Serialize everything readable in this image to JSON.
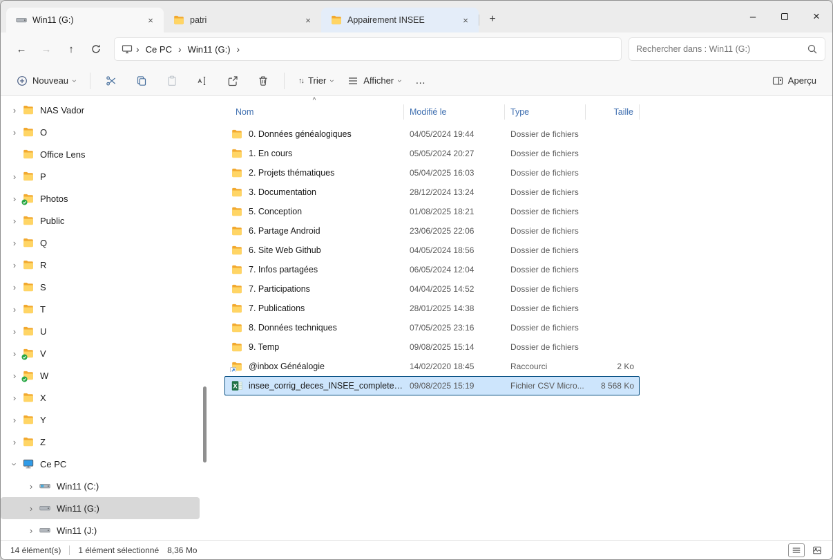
{
  "window": {
    "tabs": [
      {
        "icon": "drive",
        "label": "Win11 (G:)",
        "state": "active"
      },
      {
        "icon": "folder",
        "label": "patri",
        "state": "normal"
      },
      {
        "icon": "folder",
        "label": "Appairement INSEE",
        "state": "highlighted"
      }
    ]
  },
  "nav": {
    "breadcrumb": [
      "Ce PC",
      "Win11 (G:)"
    ],
    "search_placeholder": "Rechercher dans : Win11 (G:)"
  },
  "toolbar": {
    "new_label": "Nouveau",
    "sort_label": "Trier",
    "view_label": "Afficher",
    "preview_label": "Aperçu",
    "buttons": [
      {
        "name": "cut",
        "enabled": true
      },
      {
        "name": "copy",
        "enabled": true
      },
      {
        "name": "paste",
        "enabled": false
      },
      {
        "name": "rename",
        "enabled": true
      },
      {
        "name": "share",
        "enabled": true
      },
      {
        "name": "delete",
        "enabled": true
      }
    ]
  },
  "sidebar": {
    "items": [
      {
        "label": "NAS Vador",
        "icon": "folder",
        "chevron": true
      },
      {
        "label": "O",
        "icon": "folder",
        "chevron": true
      },
      {
        "label": "Office Lens",
        "icon": "folder",
        "chevron": false
      },
      {
        "label": "P",
        "icon": "folder",
        "chevron": true
      },
      {
        "label": "Photos",
        "icon": "folder",
        "chevron": true,
        "badge": "check"
      },
      {
        "label": "Public",
        "icon": "folder",
        "chevron": true
      },
      {
        "label": "Q",
        "icon": "folder",
        "chevron": true
      },
      {
        "label": "R",
        "icon": "folder",
        "chevron": true
      },
      {
        "label": "S",
        "icon": "folder",
        "chevron": true
      },
      {
        "label": "T",
        "icon": "folder",
        "chevron": true
      },
      {
        "label": "U",
        "icon": "folder",
        "chevron": true
      },
      {
        "label": "V",
        "icon": "folder",
        "chevron": true,
        "badge": "check"
      },
      {
        "label": "W",
        "icon": "folder",
        "chevron": true,
        "badge": "check"
      },
      {
        "label": "X",
        "icon": "folder",
        "chevron": true
      },
      {
        "label": "Y",
        "icon": "folder",
        "chevron": true
      },
      {
        "label": "Z",
        "icon": "folder",
        "chevron": true
      },
      {
        "label": "Ce PC",
        "icon": "pc",
        "chevron": true,
        "expanded": true
      },
      {
        "label": "Win11 (C:)",
        "icon": "drive-os",
        "chevron": true,
        "depth": 1
      },
      {
        "label": "Win11 (G:)",
        "icon": "drive",
        "chevron": true,
        "depth": 1,
        "selected": true
      },
      {
        "label": "Win11 (J:)",
        "icon": "drive",
        "chevron": true,
        "depth": 1
      }
    ]
  },
  "main": {
    "columns": [
      {
        "label": "Nom",
        "key": "name",
        "sorted": true
      },
      {
        "label": "Modifié le",
        "key": "mod"
      },
      {
        "label": "Type",
        "key": "type"
      },
      {
        "label": "Taille",
        "key": "size"
      }
    ],
    "rows": [
      {
        "icon": "folder",
        "name": "0. Données généalogiques",
        "modified": "04/05/2024 19:44",
        "type": "Dossier de fichiers",
        "size": ""
      },
      {
        "icon": "folder",
        "name": "1. En cours",
        "modified": "05/05/2024 20:27",
        "type": "Dossier de fichiers",
        "size": ""
      },
      {
        "icon": "folder",
        "name": "2. Projets thématiques",
        "modified": "05/04/2025 16:03",
        "type": "Dossier de fichiers",
        "size": ""
      },
      {
        "icon": "folder",
        "name": "3. Documentation",
        "modified": "28/12/2024 13:24",
        "type": "Dossier de fichiers",
        "size": ""
      },
      {
        "icon": "folder",
        "name": "5. Conception",
        "modified": "01/08/2025 18:21",
        "type": "Dossier de fichiers",
        "size": ""
      },
      {
        "icon": "folder",
        "name": "6. Partage Android",
        "modified": "23/06/2025 22:06",
        "type": "Dossier de fichiers",
        "size": ""
      },
      {
        "icon": "folder",
        "name": "6. Site Web Github",
        "modified": "04/05/2024 18:56",
        "type": "Dossier de fichiers",
        "size": ""
      },
      {
        "icon": "folder",
        "name": "7. Infos partagées",
        "modified": "06/05/2024 12:04",
        "type": "Dossier de fichiers",
        "size": ""
      },
      {
        "icon": "folder",
        "name": "7. Participations",
        "modified": "04/04/2025 14:52",
        "type": "Dossier de fichiers",
        "size": ""
      },
      {
        "icon": "folder",
        "name": "7. Publications",
        "modified": "28/01/2025 14:38",
        "type": "Dossier de fichiers",
        "size": ""
      },
      {
        "icon": "folder",
        "name": "8. Données techniques",
        "modified": "07/05/2025 23:16",
        "type": "Dossier de fichiers",
        "size": ""
      },
      {
        "icon": "folder",
        "name": "9. Temp",
        "modified": "09/08/2025 15:14",
        "type": "Dossier de fichiers",
        "size": ""
      },
      {
        "icon": "shortcut",
        "name": "@inbox Généalogie",
        "modified": "14/02/2020 18:45",
        "type": "Raccourci",
        "size": "2 Ko"
      },
      {
        "icon": "csv",
        "name": "insee_corrig_deces_INSEE_complete.csv",
        "modified": "09/08/2025 15:19",
        "type": "Fichier CSV Micro...",
        "size": "8 568 Ko",
        "selected": true
      }
    ]
  },
  "statusbar": {
    "items_count": "14 élément(s)",
    "selection_text": "1 élément sélectionné",
    "selection_size": "8,36 Mo"
  }
}
